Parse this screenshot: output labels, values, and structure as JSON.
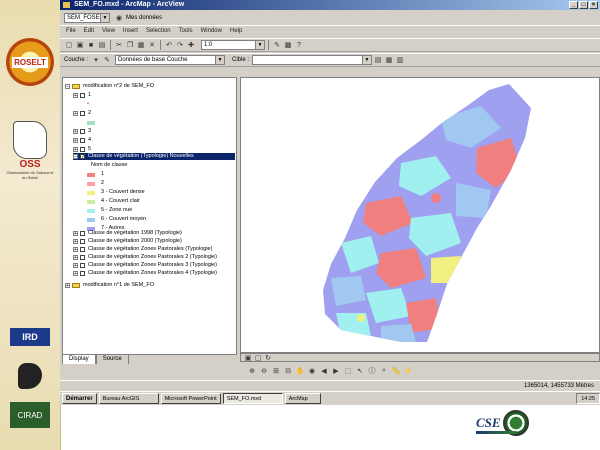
{
  "window": {
    "title": "SEM_FO.mxd - ArcMap - ArcView"
  },
  "address": {
    "combo": "SEM_FOSELT",
    "label": "Mes données"
  },
  "menus": [
    "File",
    "Edit",
    "View",
    "Insert",
    "Selection",
    "Tools",
    "Window",
    "Help"
  ],
  "toolbar": {
    "scale_value": "1:0",
    "layer_label": "Couche :",
    "layer_value": "Données de base Couche",
    "target_label": "Cible :"
  },
  "toc": {
    "dataframe1": "modification n°2 de SEM_FO",
    "layers": [
      "1",
      "2",
      "3",
      "4",
      "5",
      "6"
    ],
    "selected_layer": "Classe de végétation (Typologie) Nouvelles",
    "legend_header": "Nom de classe",
    "legend_items": [
      {
        "label": "1",
        "color": "#f08080"
      },
      {
        "label": "2",
        "color": "#ffa0a0"
      },
      {
        "label": "3 - Couvert dense",
        "color": "#f0f080"
      },
      {
        "label": "4 - Couvert clair",
        "color": "#c8f0a0"
      },
      {
        "label": "5 - Zone nue",
        "color": "#a0f0f0"
      },
      {
        "label": "6 - Couvert moyen",
        "color": "#a0c8f0"
      },
      {
        "label": "7 - Autres",
        "color": "#a0a0f0"
      }
    ],
    "other_layers": [
      "Classe de végétation 1998 (Typologie)",
      "Classe de végétation 2000 (Typologie)",
      "Classe de végétation Zones Pastorales (Typologie)",
      "Classe de végétation Zones Pastorales 2 (Typologie)",
      "Classe de végétation Zones Pastorales 3 (Typologie)",
      "Classe de végétation Zones Pastorales 4 (Typologie)"
    ],
    "dataframe2": "modification n°1 de SEM_FO",
    "tabs": [
      "Display",
      "Source"
    ]
  },
  "status": {
    "coords": "1365014, 1455733 Mètres"
  },
  "taskbar": {
    "start": "Démarrer",
    "tasks": [
      "Bureau ArcGIS",
      "Microsoft PowerPoint",
      "SEM_FO.mxd",
      "ArcMap"
    ],
    "clock": "14:25"
  },
  "logos": {
    "roselt": "ROSELT",
    "oss": "OSS",
    "oss_sub": "Observatoire du Sahara et du Sahel",
    "ird": "IRD",
    "cirad": "CIRAD",
    "cse": "CSE"
  },
  "colors": {
    "blue": "#a0a0f0",
    "pink": "#f08080",
    "cyan": "#a0f0f0",
    "lightblue": "#a0c8f0",
    "yellow": "#f0f080",
    "green": "#c8f0a0"
  }
}
